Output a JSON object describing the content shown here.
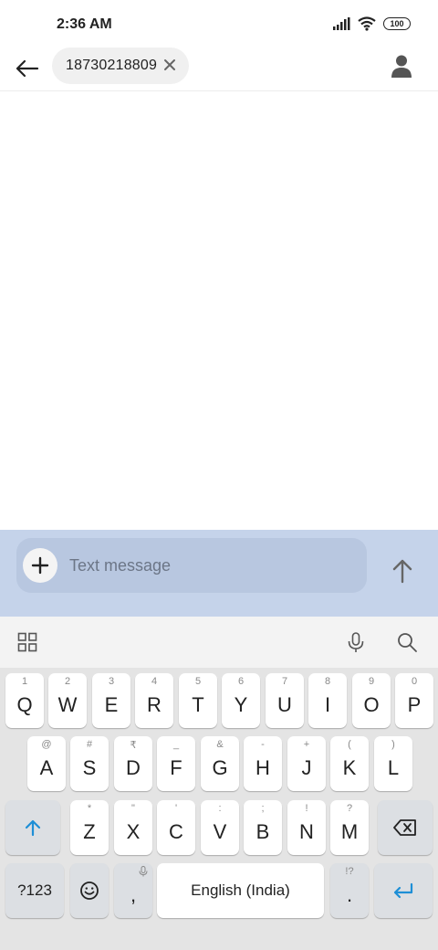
{
  "status_bar": {
    "time": "2:36 AM",
    "battery": "100"
  },
  "header": {
    "recipient": "18730218809"
  },
  "compose": {
    "placeholder": "Text message"
  },
  "keyboard": {
    "row1": [
      {
        "hint": "1",
        "label": "Q"
      },
      {
        "hint": "2",
        "label": "W"
      },
      {
        "hint": "3",
        "label": "E"
      },
      {
        "hint": "4",
        "label": "R"
      },
      {
        "hint": "5",
        "label": "T"
      },
      {
        "hint": "6",
        "label": "Y"
      },
      {
        "hint": "7",
        "label": "U"
      },
      {
        "hint": "8",
        "label": "I"
      },
      {
        "hint": "9",
        "label": "O"
      },
      {
        "hint": "0",
        "label": "P"
      }
    ],
    "row2": [
      {
        "hint": "@",
        "label": "A"
      },
      {
        "hint": "#",
        "label": "S"
      },
      {
        "hint": "₹",
        "label": "D"
      },
      {
        "hint": "_",
        "label": "F"
      },
      {
        "hint": "&",
        "label": "G"
      },
      {
        "hint": "-",
        "label": "H"
      },
      {
        "hint": "+",
        "label": "J"
      },
      {
        "hint": "(",
        "label": "K"
      },
      {
        "hint": ")",
        "label": "L"
      }
    ],
    "row3": [
      {
        "hint": "*",
        "label": "Z"
      },
      {
        "hint": "\"",
        "label": "X"
      },
      {
        "hint": "'",
        "label": "C"
      },
      {
        "hint": ":",
        "label": "V"
      },
      {
        "hint": ";",
        "label": "B"
      },
      {
        "hint": "!",
        "label": "N"
      },
      {
        "hint": "?",
        "label": "M"
      }
    ],
    "symbols_label": "?123",
    "comma": ",",
    "space_label": "English (India)",
    "period": ".",
    "period_hint": "!?"
  }
}
